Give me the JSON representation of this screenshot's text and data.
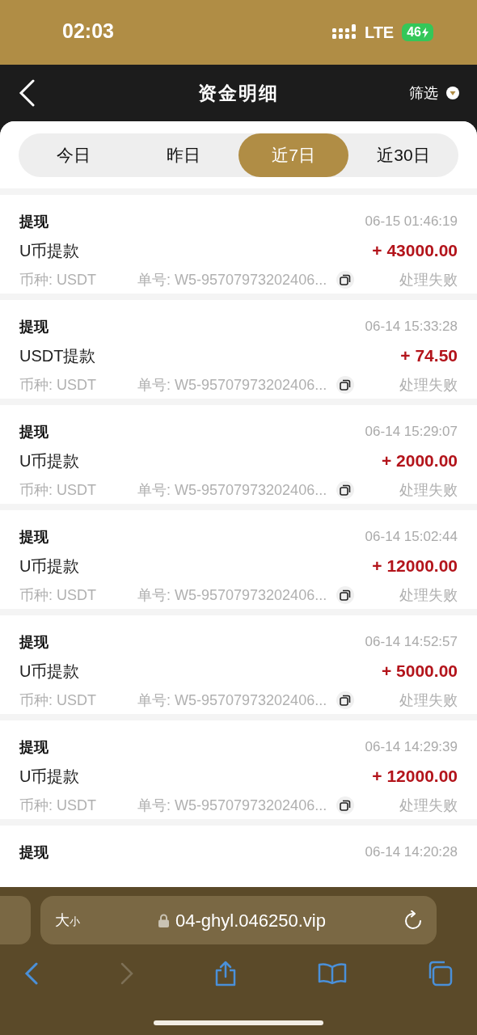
{
  "status_bar": {
    "time": "02:03",
    "network": "LTE",
    "battery": "46"
  },
  "nav": {
    "title": "资金明细",
    "filter_label": "筛选"
  },
  "tabs": [
    {
      "label": "今日",
      "selected": false
    },
    {
      "label": "昨日",
      "selected": false
    },
    {
      "label": "近7日",
      "selected": true
    },
    {
      "label": "近30日",
      "selected": false
    }
  ],
  "records": [
    {
      "title": "提现",
      "time": "06-15 01:46:19",
      "name": "U币提款",
      "amount": "+ 43000.00",
      "currency": "币种: USDT",
      "order_no": "单号: W5-95707973202406...",
      "status": "处理失败"
    },
    {
      "title": "提现",
      "time": "06-14 15:33:28",
      "name": "USDT提款",
      "amount": "+ 74.50",
      "currency": "币种: USDT",
      "order_no": "单号: W5-95707973202406...",
      "status": "处理失败"
    },
    {
      "title": "提现",
      "time": "06-14 15:29:07",
      "name": "U币提款",
      "amount": "+ 2000.00",
      "currency": "币种: USDT",
      "order_no": "单号: W5-95707973202406...",
      "status": "处理失败"
    },
    {
      "title": "提现",
      "time": "06-14 15:02:44",
      "name": "U币提款",
      "amount": "+ 12000.00",
      "currency": "币种: USDT",
      "order_no": "单号: W5-95707973202406...",
      "status": "处理失败"
    },
    {
      "title": "提现",
      "time": "06-14 14:52:57",
      "name": "U币提款",
      "amount": "+ 5000.00",
      "currency": "币种: USDT",
      "order_no": "单号: W5-95707973202406...",
      "status": "处理失败"
    },
    {
      "title": "提现",
      "time": "06-14 14:29:39",
      "name": "U币提款",
      "amount": "+ 12000.00",
      "currency": "币种: USDT",
      "order_no": "单号: W5-95707973202406...",
      "status": "处理失败"
    },
    {
      "title": "提现",
      "time": "06-14 14:20:28"
    }
  ],
  "browser": {
    "text_size_big": "大",
    "text_size_small": "小",
    "url": "04-ghyl.046250.vip"
  }
}
